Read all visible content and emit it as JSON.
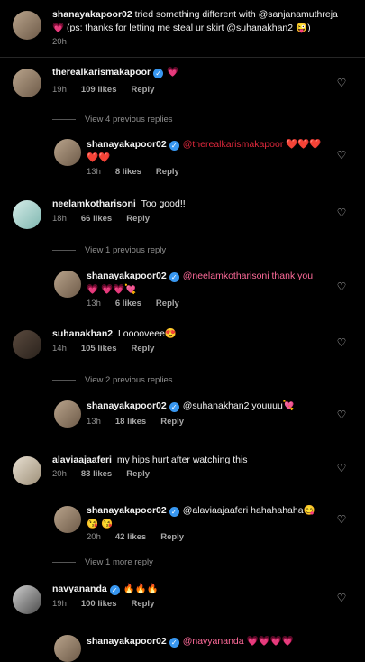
{
  "caption": {
    "username": "shanayakapoor02",
    "text": "tried something different with @sanjanamuthreja 💗 (ps: thanks for letting me steal ur skirt  @suhanakhan2 😜)",
    "time": "20h"
  },
  "comments": [
    {
      "username": "therealkarismakapoor",
      "verified": true,
      "text": "💗",
      "time": "19h",
      "likes": "109 likes",
      "reply": "Reply"
    },
    {
      "username": "shanayakapoor02",
      "verified": true,
      "text": "@therealkarismakapoor ❤️❤️❤️ ❤️❤️",
      "time": "13h",
      "likes": "8 likes",
      "reply": "Reply"
    },
    {
      "username": "neelamkotharisoni",
      "verified": false,
      "text": "Too good!!",
      "time": "18h",
      "likes": "66 likes",
      "reply": "Reply"
    },
    {
      "username": "shanayakapoor02",
      "verified": true,
      "text": "@neelamkotharisoni thank you 💗 💗💗💘",
      "time": "13h",
      "likes": "6 likes",
      "reply": "Reply"
    },
    {
      "username": "suhanakhan2",
      "verified": false,
      "text": "Looooveee😍",
      "time": "14h",
      "likes": "105 likes",
      "reply": "Reply"
    },
    {
      "username": "shanayakapoor02",
      "verified": true,
      "text": "@suhanakhan2 youuuu💘",
      "time": "13h",
      "likes": "18 likes",
      "reply": "Reply"
    },
    {
      "username": "alaviaajaaferi",
      "verified": false,
      "text": "my hips hurt after watching this",
      "time": "20h",
      "likes": "83 likes",
      "reply": "Reply"
    },
    {
      "username": "shanayakapoor02",
      "verified": true,
      "text": "@alaviaajaaferi hahahahaha😋😘 😘",
      "time": "20h",
      "likes": "42 likes",
      "reply": "Reply"
    },
    {
      "username": "navyananda",
      "verified": true,
      "text": "🔥🔥🔥",
      "time": "19h",
      "likes": "100 likes",
      "reply": "Reply"
    },
    {
      "username": "shanayakapoor02",
      "verified": true,
      "text": "@navyananda 💗💗💗💗",
      "time": "",
      "likes": "",
      "reply": ""
    }
  ],
  "view_replies": [
    "View 4 previous replies",
    "View 1 previous reply",
    "View 2 previous replies",
    "View 1 more reply"
  ],
  "icons": {
    "heart": "heart-outline-icon",
    "verified": "verified-badge-icon"
  }
}
